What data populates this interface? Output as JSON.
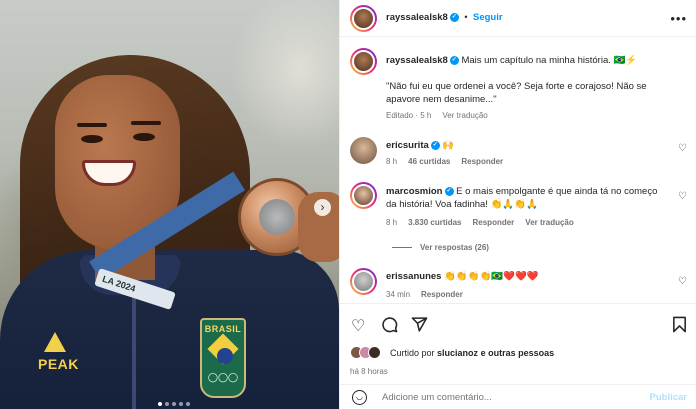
{
  "post_image": {
    "lanyard_text": "LA 2024",
    "jacket_badge": "BRASIL",
    "jacket_brand": "PEAK",
    "carousel_next_icon": "chevron-right-icon",
    "carousel": {
      "total_slides": 5,
      "active_slide": 1
    }
  },
  "header": {
    "username": "rayssalealsk8",
    "separator": "•",
    "follow_label": "Seguir",
    "more_icon": "more-horizontal-icon"
  },
  "caption": {
    "username": "rayssalealsk8",
    "text": "Mais um capítulo na minha história. 🇧🇷⚡",
    "quote": "\"Não fui eu que ordenei a você? Seja forte e corajoso! Não se apavore nem desanime...\"",
    "edited": "Editado",
    "time": "5 h",
    "see_translation": "Ver tradução"
  },
  "comments": [
    {
      "username": "ericsurita",
      "text": "🙌",
      "time": "8 h",
      "likes": "46 curtidas",
      "reply": "Responder"
    },
    {
      "username": "marcosmion",
      "text": "E o mais empolgante é que ainda tá no começo da história! Voa fadinha! 👏🙏👏🙏",
      "time": "8 h",
      "likes": "3.830 curtidas",
      "reply": "Responder",
      "see_translation": "Ver tradução",
      "view_replies": "Ver respostas (26)"
    },
    {
      "username": "erissanunes",
      "text": "👏👏👏👏🇧🇷❤️❤️❤️",
      "time": "34 min",
      "reply": "Responder"
    }
  ],
  "actions": {
    "like_icon": "heart-icon",
    "comment_icon": "comment-icon",
    "share_icon": "send-icon",
    "save_icon": "bookmark-icon",
    "liked_by_prefix": "Curtido por",
    "liked_by_user": "slucianoz",
    "liked_by_suffix": "e outras pessoas",
    "posted_ago": "há 8 horas"
  },
  "comment_box": {
    "emoji_icon": "emoji-icon",
    "placeholder": "Adicione um comentário...",
    "publish_label": "Publicar"
  },
  "colors": {
    "link_blue": "#0095f6",
    "muted_gray": "#737373",
    "verified_blue": "#0095f6",
    "publish_disabled": "#b2dffc"
  }
}
